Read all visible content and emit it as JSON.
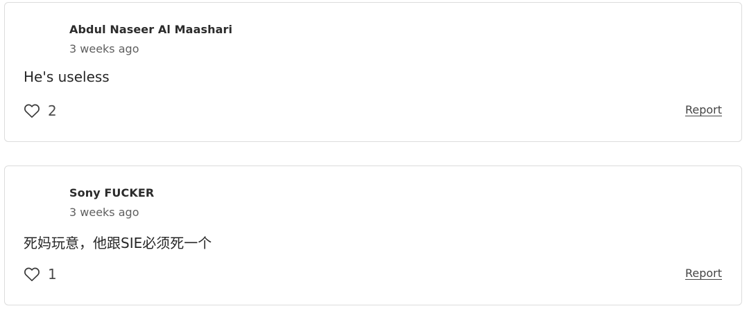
{
  "reviews": [
    {
      "author": "Abdul Naseer Al Maashari",
      "time": "3 weeks ago",
      "text": "He's useless",
      "likes": "2",
      "report_label": "Report"
    },
    {
      "author": "Sony FUCKER",
      "time": "3 weeks ago",
      "text": "死妈玩意，他跟SIE必须死一个",
      "likes": "1",
      "report_label": "Report"
    }
  ],
  "icons": {
    "like": "heart-outline-icon"
  },
  "colors": {
    "border": "#dcdcdc",
    "text": "#222222",
    "muted": "#5f5f5f"
  }
}
